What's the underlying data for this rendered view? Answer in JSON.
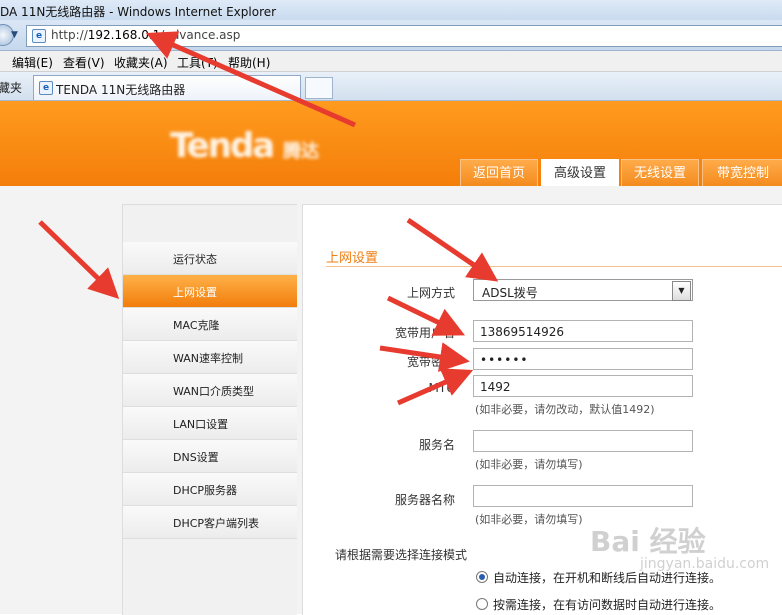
{
  "window": {
    "title": "DA 11N无线路由器 - Windows Internet Explorer"
  },
  "address": {
    "prefix": "http://",
    "host": "192.168.0.1",
    "path": "/advance.asp"
  },
  "menu": [
    "编辑(E)",
    "查看(V)",
    "收藏夹(A)",
    "工具(T)",
    "帮助(H)"
  ],
  "favorites_label": "藏夹",
  "tab": {
    "title": "TENDA 11N无线路由器"
  },
  "logo": {
    "text": "Tenda",
    "sub": "腾达"
  },
  "top_tabs": [
    {
      "label": "返回首页",
      "active": false
    },
    {
      "label": "高级设置",
      "active": true
    },
    {
      "label": "无线设置",
      "active": false
    },
    {
      "label": "带宽控制",
      "active": false
    }
  ],
  "sidebar": {
    "items": [
      {
        "label": "运行状态",
        "active": false
      },
      {
        "label": "上网设置",
        "active": true
      },
      {
        "label": "MAC克隆",
        "active": false
      },
      {
        "label": "WAN速率控制",
        "active": false
      },
      {
        "label": "WAN口介质类型",
        "active": false
      },
      {
        "label": "LAN口设置",
        "active": false
      },
      {
        "label": "DNS设置",
        "active": false
      },
      {
        "label": "DHCP服务器",
        "active": false
      },
      {
        "label": "DHCP客户端列表",
        "active": false
      }
    ]
  },
  "form": {
    "section_title": "上网设置",
    "mode_label": "上网方式",
    "mode_value": "ADSL拨号",
    "user_label": "宽带用户名",
    "user_value": "13869514926",
    "pass_label": "宽带密码",
    "pass_value": "••••••",
    "mtu_label": "MTU",
    "mtu_value": "1492",
    "mtu_hint": "(如非必要，请勿改动，默认值1492)",
    "service_label": "服务名",
    "service_value": "",
    "service_hint": "(如非必要，请勿填写)",
    "server_label": "服务器名称",
    "server_value": "",
    "server_hint": "(如非必要，请勿填写)",
    "connect_prompt": "请根据需要选择连接模式",
    "connect_options": [
      {
        "label": "自动连接，在开机和断线后自动进行连接。",
        "checked": true
      },
      {
        "label": "按需连接，在有访问数据时自动进行连接。",
        "checked": false
      }
    ]
  },
  "watermark": {
    "text": "Bai 经验",
    "sub": "jingyan.baidu.com"
  },
  "colors": {
    "orange": "#f47e0a",
    "arrow": "#e63b2e"
  }
}
